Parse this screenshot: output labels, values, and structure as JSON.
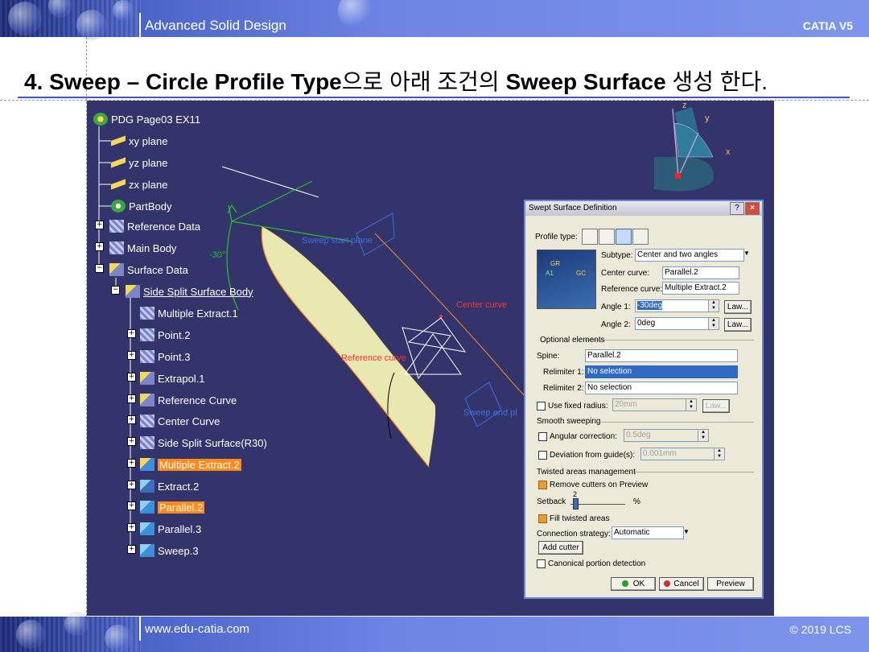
{
  "slide": {
    "header_title": "Advanced Solid Design",
    "header_right": "CATIA V5",
    "footer_left": "www.edu-catia.com",
    "footer_right": "© 2019 LCS",
    "title_num": "4.",
    "title_part1": "Sweep – Circle Profile Type",
    "title_part2": "으로 아래 조건의 ",
    "title_part3": "Sweep Surface",
    "title_part4": " 생성 한다."
  },
  "tree": {
    "root": "PDG Page03 EX11",
    "planes": [
      "xy plane",
      "yz plane",
      "zx plane"
    ],
    "partbody": "PartBody",
    "reference_data": "Reference Data",
    "main_body": "Main Body",
    "surface_data": "Surface Data",
    "side_split": "Side Split Surface Body",
    "children": [
      "Multiple Extract.1",
      "Point.2",
      "Point.3",
      "Extrapol.1",
      "Reference Curve",
      "Center Curve",
      "Side Split Surface(R30)",
      "Multiple Extract.2",
      "Extract.2",
      "Parallel.2",
      "Parallel.3",
      "Sweep.3"
    ]
  },
  "viewport": {
    "annotations": {
      "sweep_start_plane": "Sweep start plane",
      "center_curve": "Center curve",
      "reference_curve": "Reference curve",
      "sweep_end_plane": "Sweep end pl",
      "angle_label": "-30°"
    },
    "compass": {
      "z": "z",
      "y": "y",
      "x": "x"
    },
    "colors": {
      "background": "#34346c",
      "surface": "#e8e8b0",
      "highlight": "#ff8c1a"
    }
  },
  "dialog": {
    "title": "Swept Surface Definition",
    "help": "?",
    "close": "×",
    "profile_type_label": "Profile type:",
    "subtype_label": "Subtype:",
    "subtype_value": "Center and two angles",
    "center_curve_label": "Center curve:",
    "center_curve_value": "Parallel.2",
    "reference_curve_label": "Reference curve:",
    "reference_curve_value": "Multiple Extract.2",
    "angle1_label": "Angle 1:",
    "angle1_value": "-30deg",
    "angle2_label": "Angle 2:",
    "angle2_value": "0deg",
    "law": "Law...",
    "optional_elements": "Optional elements",
    "spine_label": "Spine:",
    "spine_value": "Parallel.2",
    "relimiter1_label": "Relimiter 1:",
    "relimiter1_value": "No selection",
    "relimiter2_label": "Relimiter 2:",
    "relimiter2_value": "No selection",
    "use_fixed_radius": "Use fixed radius:",
    "fixed_radius_value": "20mm",
    "smooth_sweeping": "Smooth sweeping",
    "angular_correction": "Angular correction:",
    "angular_value": "0.5deg",
    "deviation": "Deviation from guide(s):",
    "deviation_value": "0.001mm",
    "twisted_areas": "Twisted areas management",
    "remove_cutters": "Remove cutters on Preview",
    "setback_label": "Setback",
    "setback_value": "2",
    "setback_unit": "%",
    "fill_twisted": "Fill twisted areas",
    "connection_strategy_label": "Connection strategy:",
    "connection_strategy_value": "Automatic",
    "add_cutter": "Add cutter",
    "canonical": "Canonical portion detection",
    "ok": "OK",
    "cancel": "Cancel",
    "preview": "Preview",
    "preview_labels": {
      "gr": "GR",
      "gc": "GC",
      "a1": "A1"
    }
  }
}
